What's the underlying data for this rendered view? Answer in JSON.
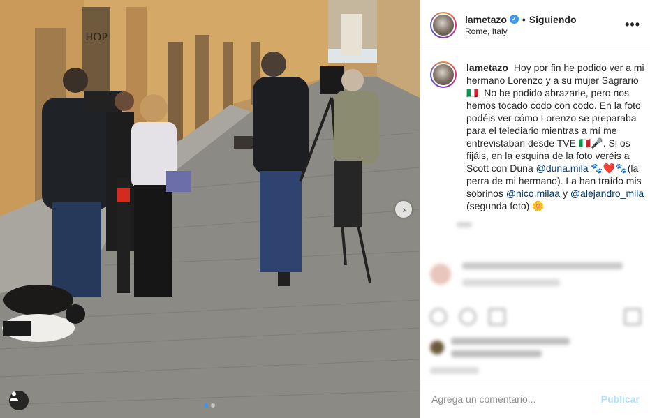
{
  "post": {
    "username": "lametazo",
    "separator": "•",
    "follow_label": "Siguiendo",
    "location": "Rome, Italy",
    "more_label": "•••",
    "verified_badge": "✓"
  },
  "photo": {
    "shop_sign": "HOP",
    "next_label": "›"
  },
  "caption": {
    "username": "lametazo",
    "text_1": "Hoy por fin he podido ver a mi hermano Lorenzo y a su mujer Sagrario 🇮🇹. No he podido abrazarle, pero nos hemos tocado codo con codo. En la foto podéis ver cómo Lorenzo se preparaba para el telediario mientras a mí me entrevistaban desde TVE 🇮🇹🎤. Si os fijáis, en la esquina de la foto veréis a Scott con Duna ",
    "mention_1": "@duna.mila",
    "text_2": " 🐾❤️🐾(la perra de mi hermano). La han traído mis sobrinos ",
    "mention_2": "@nico.milaa",
    "text_3": " y ",
    "mention_3": "@alejandro_mila",
    "text_4": " (segunda foto) 🌼"
  },
  "comment_input": {
    "placeholder": "Agrega un comentario...",
    "publish_label": "Publicar"
  },
  "colors": {
    "accent": "#3897f0",
    "publish_disabled": "#b2dffc",
    "mention": "#00376b"
  }
}
